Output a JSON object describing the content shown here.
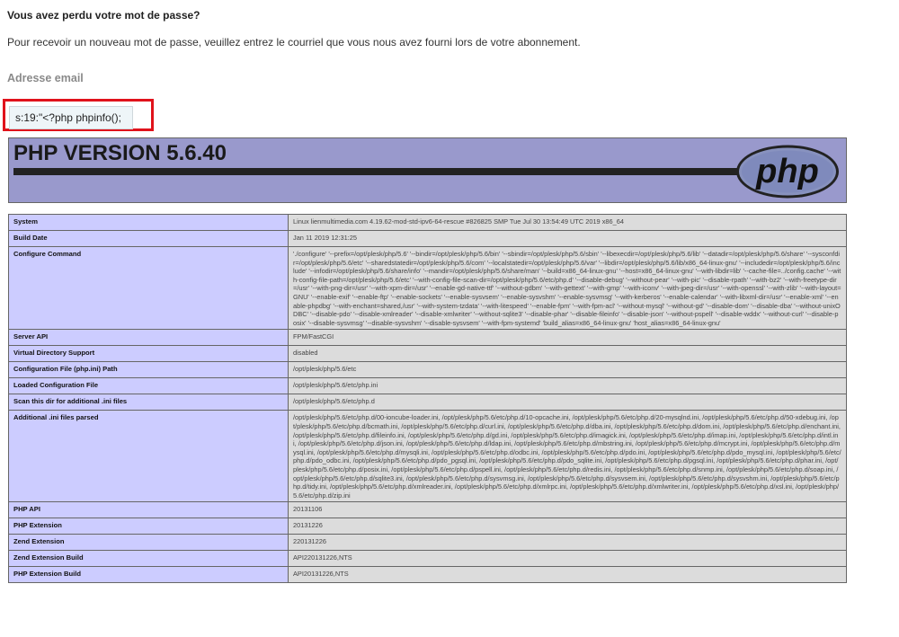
{
  "page": {
    "title": "Vous avez perdu votre mot de passe?",
    "intro": "Pour recevoir un nouveau mot de passe, veuillez entrez le courriel que vous nous avez fourni lors de votre abonnement.",
    "email_label": "Adresse email",
    "email_value": "s:19:\"<?php phpinfo();"
  },
  "phpinfo": {
    "version_title": "PHP VERSION 5.6.40",
    "logo_text": "php",
    "rows": [
      {
        "key": "System",
        "value": "Linux lienmultimedia.com 4.19.62-mod-std-ipv6-64-rescue #826825 SMP Tue Jul 30 13:54:49 UTC 2019 x86_64"
      },
      {
        "key": "Build Date",
        "value": "Jan 11 2019 12:31:25"
      },
      {
        "key": "Configure Command",
        "value": "'./configure' '--prefix=/opt/plesk/php/5.6' '--bindir=/opt/plesk/php/5.6/bin' '--sbindir=/opt/plesk/php/5.6/sbin' '--libexecdir=/opt/plesk/php/5.6/lib' '--datadir=/opt/plesk/php/5.6/share' '--sysconfdir=/opt/plesk/php/5.6/etc' '--sharedstatedir=/opt/plesk/php/5.6/com' '--localstatedir=/opt/plesk/php/5.6/var' '--libdir=/opt/plesk/php/5.6/lib/x86_64-linux-gnu' '--includedir=/opt/plesk/php/5.6/include' '--infodir=/opt/plesk/php/5.6/share/info' '--mandir=/opt/plesk/php/5.6/share/man' '--build=x86_64-linux-gnu' '--host=x86_64-linux-gnu' '--with-libdir=lib' '--cache-file=../config.cache' '--with-config-file-path=/opt/plesk/php/5.6/etc' '--with-config-file-scan-dir=/opt/plesk/php/5.6/etc/php.d' '--disable-debug' '--without-pear' '--with-pic' '--disable-rpath' '--with-bz2' '--with-freetype-dir=/usr' '--with-png-dir=/usr' '--with-xpm-dir=/usr' '--enable-gd-native-ttf' '--without-gdbm' '--with-gettext' '--with-gmp' '--with-iconv' '--with-jpeg-dir=/usr' '--with-openssl' '--with-zlib' '--with-layout=GNU' '--enable-exif' '--enable-ftp' '--enable-sockets' '--enable-sysvsem' '--enable-sysvshm' '--enable-sysvmsg' '--with-kerberos' '--enable-calendar' '--with-libxml-dir=/usr' '--enable-xml' '--enable-phpdbg' '--with-enchant=shared,/usr' '--with-system-tzdata' '--with-litespeed' '--enable-fpm' '--with-fpm-acl' '--without-mysql' '--without-gd' '--disable-dom' '--disable-dba' '--without-unixODBC' '--disable-pdo' '--disable-xmlreader' '--disable-xmlwriter' '--without-sqlite3' '--disable-phar' '--disable-fileinfo' '--disable-json' '--without-pspell' '--disable-wddx' '--without-curl' '--disable-posix' '--disable-sysvmsg' '--disable-sysvshm' '--disable-sysvsem' '--with-fpm-systemd' 'build_alias=x86_64-linux-gnu' 'host_alias=x86_64-linux-gnu'"
      },
      {
        "key": "Server API",
        "value": "FPM/FastCGI"
      },
      {
        "key": "Virtual Directory Support",
        "value": "disabled"
      },
      {
        "key": "Configuration File (php.ini) Path",
        "value": "/opt/plesk/php/5.6/etc"
      },
      {
        "key": "Loaded Configuration File",
        "value": "/opt/plesk/php/5.6/etc/php.ini"
      },
      {
        "key": "Scan this dir for additional .ini files",
        "value": "/opt/plesk/php/5.6/etc/php.d"
      },
      {
        "key": "Additional .ini files parsed",
        "value": "/opt/plesk/php/5.6/etc/php.d/00-ioncube-loader.ini, /opt/plesk/php/5.6/etc/php.d/10-opcache.ini, /opt/plesk/php/5.6/etc/php.d/20-mysqlnd.ini, /opt/plesk/php/5.6/etc/php.d/50-xdebug.ini, /opt/plesk/php/5.6/etc/php.d/bcmath.ini, /opt/plesk/php/5.6/etc/php.d/curl.ini, /opt/plesk/php/5.6/etc/php.d/dba.ini, /opt/plesk/php/5.6/etc/php.d/dom.ini, /opt/plesk/php/5.6/etc/php.d/enchant.ini, /opt/plesk/php/5.6/etc/php.d/fileinfo.ini, /opt/plesk/php/5.6/etc/php.d/gd.ini, /opt/plesk/php/5.6/etc/php.d/imagick.ini, /opt/plesk/php/5.6/etc/php.d/imap.ini, /opt/plesk/php/5.6/etc/php.d/intl.ini, /opt/plesk/php/5.6/etc/php.d/json.ini, /opt/plesk/php/5.6/etc/php.d/ldap.ini, /opt/plesk/php/5.6/etc/php.d/mbstring.ini, /opt/plesk/php/5.6/etc/php.d/mcrypt.ini, /opt/plesk/php/5.6/etc/php.d/mysql.ini, /opt/plesk/php/5.6/etc/php.d/mysqli.ini, /opt/plesk/php/5.6/etc/php.d/odbc.ini, /opt/plesk/php/5.6/etc/php.d/pdo.ini, /opt/plesk/php/5.6/etc/php.d/pdo_mysql.ini, /opt/plesk/php/5.6/etc/php.d/pdo_odbc.ini, /opt/plesk/php/5.6/etc/php.d/pdo_pgsql.ini, /opt/plesk/php/5.6/etc/php.d/pdo_sqlite.ini, /opt/plesk/php/5.6/etc/php.d/pgsql.ini, /opt/plesk/php/5.6/etc/php.d/phar.ini, /opt/plesk/php/5.6/etc/php.d/posix.ini, /opt/plesk/php/5.6/etc/php.d/pspell.ini, /opt/plesk/php/5.6/etc/php.d/redis.ini, /opt/plesk/php/5.6/etc/php.d/snmp.ini, /opt/plesk/php/5.6/etc/php.d/soap.ini, /opt/plesk/php/5.6/etc/php.d/sqlite3.ini, /opt/plesk/php/5.6/etc/php.d/sysvmsg.ini, /opt/plesk/php/5.6/etc/php.d/sysvsem.ini, /opt/plesk/php/5.6/etc/php.d/sysvshm.ini, /opt/plesk/php/5.6/etc/php.d/tidy.ini, /opt/plesk/php/5.6/etc/php.d/xmlreader.ini, /opt/plesk/php/5.6/etc/php.d/xmlrpc.ini, /opt/plesk/php/5.6/etc/php.d/xmlwriter.ini, /opt/plesk/php/5.6/etc/php.d/xsl.ini, /opt/plesk/php/5.6/etc/php.d/zip.ini"
      },
      {
        "key": "PHP API",
        "value": "20131106"
      },
      {
        "key": "PHP Extension",
        "value": "20131226"
      },
      {
        "key": "Zend Extension",
        "value": "220131226"
      },
      {
        "key": "Zend Extension Build",
        "value": "API220131226,NTS"
      },
      {
        "key": "PHP Extension Build",
        "value": "API20131226,NTS"
      }
    ]
  },
  "colors": {
    "highlight": "#e0121b",
    "php_header_bg": "#9999cc",
    "key_cell_bg": "#ccccff",
    "value_cell_bg": "#dcdcdc"
  }
}
